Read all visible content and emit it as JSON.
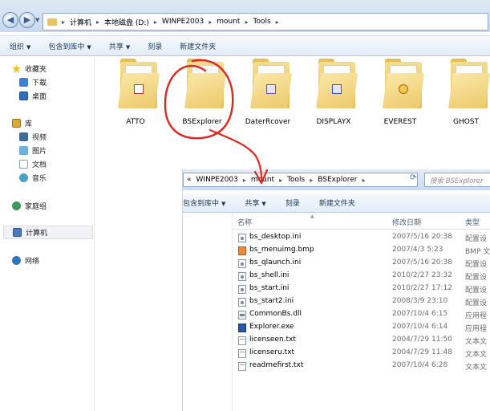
{
  "outer": {
    "path": [
      "计算机",
      "本地磁盘 (D:)",
      "WINPE2003",
      "mount",
      "Tools"
    ],
    "toolbar": [
      {
        "label": "组织",
        "dropdown": true
      },
      {
        "label": "包含到库中",
        "dropdown": true
      },
      {
        "label": "共享",
        "dropdown": true
      },
      {
        "label": "刻录",
        "dropdown": false
      },
      {
        "label": "新建文件夹",
        "dropdown": false
      }
    ],
    "sidebar": {
      "favorites": "收藏夹",
      "downloads": "下载",
      "desktop": "桌面",
      "libraries": "库",
      "videos": "视频",
      "pictures": "图片",
      "documents": "文档",
      "music": "音乐",
      "homegroup": "家庭组",
      "computer": "计算机",
      "network": "网络"
    },
    "folders": [
      "ATTO",
      "BSExplorer",
      "DaterRcover",
      "DISPLAYX",
      "EVEREST",
      "GHOST"
    ],
    "colors": {
      "folder": "#e4bf56",
      "annotation": "#e0261e",
      "accent": "#1e395b"
    }
  },
  "inner": {
    "path_prefix": "«",
    "path": [
      "WINPE2003",
      "mount",
      "Tools",
      "BSExplorer"
    ],
    "search_placeholder": "搜索 BSExplorer",
    "toolbar": [
      {
        "label": "包含到库中",
        "dropdown": true
      },
      {
        "label": "共享",
        "dropdown": true
      },
      {
        "label": "刻录",
        "dropdown": false
      },
      {
        "label": "新建文件夹",
        "dropdown": false
      }
    ],
    "columns": {
      "name": "名称",
      "date": "修改日期",
      "type": "类型"
    },
    "files": [
      {
        "name": "bs_desktop.ini",
        "date": "2007/5/16 20:38",
        "type": "配置设",
        "icon": "ini"
      },
      {
        "name": "bs_menuimg.bmp",
        "date": "2007/4/3 5:23",
        "type": "BMP 文",
        "icon": "bmp"
      },
      {
        "name": "bs_qlaunch.ini",
        "date": "2007/5/16 20:38",
        "type": "配置设",
        "icon": "ini"
      },
      {
        "name": "bs_shell.ini",
        "date": "2010/2/27 23:32",
        "type": "配置设",
        "icon": "ini"
      },
      {
        "name": "bs_start.ini",
        "date": "2010/2/27 17:12",
        "type": "配置设",
        "icon": "ini"
      },
      {
        "name": "bs_start2.ini",
        "date": "2008/3/9 23:10",
        "type": "配置设",
        "icon": "ini"
      },
      {
        "name": "CommonBs.dll",
        "date": "2007/10/4 6:15",
        "type": "应用程",
        "icon": "dll"
      },
      {
        "name": "Explorer.exe",
        "date": "2007/10/4 6:14",
        "type": "应用程",
        "icon": "exe"
      },
      {
        "name": "licenseen.txt",
        "date": "2004/7/29 11:50",
        "type": "文本文",
        "icon": "txt"
      },
      {
        "name": "licenseru.txt",
        "date": "2004/7/29 11:48",
        "type": "文本文",
        "icon": "txt"
      },
      {
        "name": "readmefirst.txt",
        "date": "2007/10/4 6:28",
        "type": "文本文",
        "icon": "txt"
      }
    ]
  }
}
